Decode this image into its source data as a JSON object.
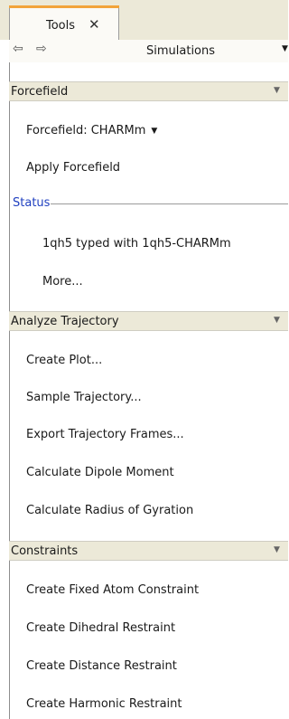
{
  "tab": {
    "title": "Tools",
    "close_glyph": "✕",
    "accent_color": "#f2a43a"
  },
  "nav": {
    "back_glyph": "⇦",
    "forward_glyph": "⇨",
    "title": "Simulations",
    "dropdown_glyph": "▼"
  },
  "sections": {
    "forcefield": {
      "title": "Forcefield",
      "chevron": "▼",
      "forcefield_label": "Forcefield: CHARMm",
      "forcefield_dropdown": "▼",
      "apply": "Apply Forcefield",
      "status_label": "Status",
      "status_text": "1qh5 typed with 1qh5-CHARMm",
      "more": "More..."
    },
    "analyze": {
      "title": "Analyze Trajectory",
      "chevron": "▼",
      "items": [
        "Create Plot...",
        "Sample Trajectory...",
        "Export Trajectory Frames...",
        "Calculate Dipole Moment",
        "Calculate Radius of Gyration"
      ]
    },
    "constraints": {
      "title": "Constraints",
      "chevron": "▼",
      "items": [
        "Create Fixed Atom Constraint",
        "Create Dihedral Restraint",
        "Create Distance Restraint",
        "Create Harmonic Restraint"
      ]
    }
  },
  "colors": {
    "header_bg": "#ece9d8",
    "panel_bg": "#ffffff",
    "status_blue": "#2040c0"
  }
}
